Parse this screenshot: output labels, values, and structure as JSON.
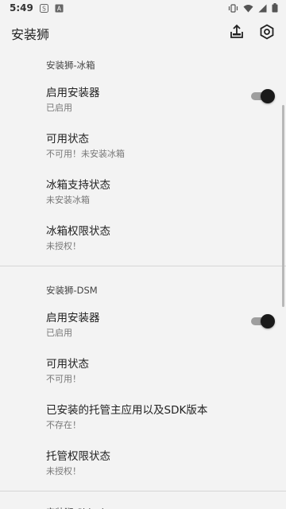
{
  "status_bar": {
    "time": "5:49",
    "icons_left": [
      "s-app-icon",
      "a-app-icon"
    ],
    "icons_right": [
      "vibrate-icon",
      "wifi-icon",
      "signal-icon",
      "battery-icon"
    ]
  },
  "app_bar": {
    "title": "安装狮",
    "actions": [
      "share-icon",
      "settings-icon"
    ]
  },
  "sections": [
    {
      "header": "安装狮-冰箱",
      "items": [
        {
          "title": "启用安装器",
          "summary": "已启用",
          "toggle": true
        },
        {
          "title": "可用状态",
          "summary": "不可用！未安装冰箱"
        },
        {
          "title": "冰箱支持状态",
          "summary": "未安装冰箱"
        },
        {
          "title": "冰箱权限状态",
          "summary": "未授权！"
        }
      ]
    },
    {
      "header": "安装狮-DSM",
      "items": [
        {
          "title": "启用安装器",
          "summary": "已启用",
          "toggle": true
        },
        {
          "title": "可用状态",
          "summary": "不可用！"
        },
        {
          "title": "已安装的托管主应用以及SDK版本",
          "summary": "不存在！"
        },
        {
          "title": "托管权限状态",
          "summary": "未授权！"
        }
      ]
    },
    {
      "header": "安装狮-Shizuku",
      "items": []
    }
  ],
  "colors": {
    "background": "#f3f3f3",
    "switch_thumb": "#1a1a1a",
    "switch_track": "#9e9e9e"
  }
}
